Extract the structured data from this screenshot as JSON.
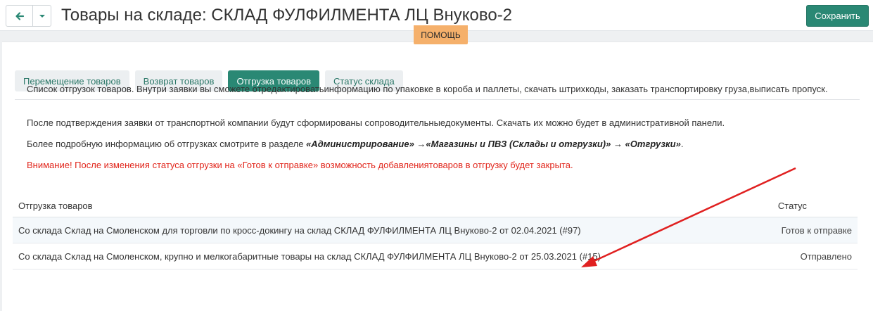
{
  "header": {
    "title": "Товары на складе: СКЛАД ФУЛФИЛМЕНТА ЛЦ Внуково-2",
    "save_label": "Сохранить",
    "help_label": "ПОМОЩЬ",
    "back_icon": "arrow-left-icon",
    "dropdown_icon": "caret-down-icon"
  },
  "tabs": [
    {
      "label": "Перемещение товаров",
      "active": false
    },
    {
      "label": "Возврат товаров",
      "active": false
    },
    {
      "label": "Отгрузка товаров",
      "active": true
    },
    {
      "label": "Статус склада",
      "active": false
    }
  ],
  "info": {
    "p1": "Список отгрузок товаров. Внутри заявки вы сможете отредактироватьинформацию по упаковке в короба и паллеты, скачать штрихкоды, заказать транспортировку груза,выписать пропуск.",
    "p2": "После подтверждения заявки от транспортной компании будут сформированы сопроводительныедокументы. Скачать их можно будет в административной панели.",
    "p3_prefix": "Более подробную информацию об отгрузках смотрите в разделе ",
    "p3_link1": "«Администрирование»",
    "p3_sep1": " →",
    "p3_link2": "«Магазины и ПВЗ (Склады и отгрузки)»",
    "p3_sep2": " → ",
    "p3_link3": "«Отгрузки»",
    "p3_suffix": ".",
    "warning": "Внимание! После изменения статуса отгрузки на «Готов к отправке» возможность добавлениятоваров в отгрузку будет закрыта."
  },
  "table": {
    "col_shipment": "Отгрузка товаров",
    "col_status": "Статус",
    "rows": [
      {
        "title": "Со склада Склад на Смоленском для торговли по кросс-докингу на склад СКЛАД ФУЛФИЛМЕНТА ЛЦ Внуково-2 от 02.04.2021 (#97)",
        "status": "Готов к отправке"
      },
      {
        "title": "Со склада Склад на Смоленском, крупно и мелкогабаритные товары на склад СКЛАД ФУЛФИЛМЕНТА ЛЦ Внуково-2 от 25.03.2021 (#15)",
        "status": "Отправлено"
      }
    ]
  },
  "colors": {
    "accent": "#2a8874",
    "help": "#f5b06b",
    "warning": "#e1251b",
    "annotation_arrow": "#e02020"
  }
}
